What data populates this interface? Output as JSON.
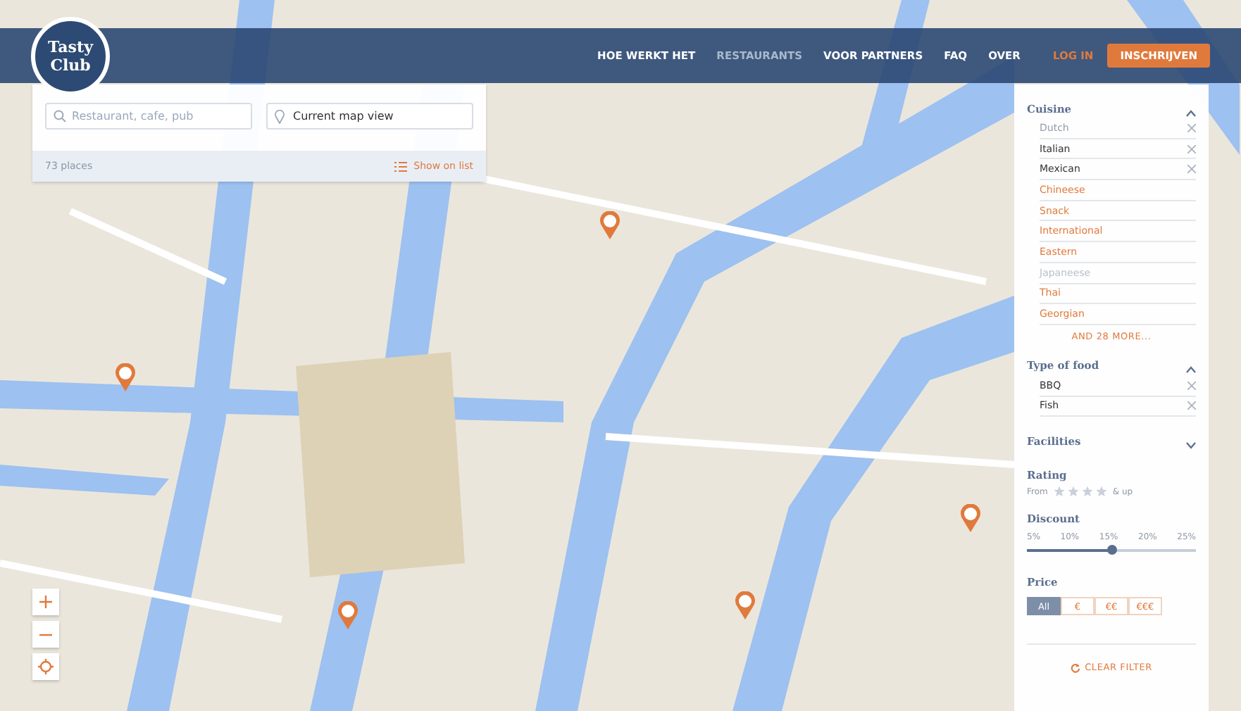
{
  "logo": {
    "line_1": "Tasty",
    "line_2": "Club"
  },
  "nav": {
    "items": [
      {
        "label": "HOE WERKT HET",
        "selected": false
      },
      {
        "label": "RESTAURANTS",
        "selected": true
      },
      {
        "label": "VOOR PARTNERS",
        "selected": false
      },
      {
        "label": "FAQ",
        "selected": false
      },
      {
        "label": "OVER",
        "selected": false
      }
    ],
    "login": "LOG IN",
    "signup": "INSCHRIJVEN"
  },
  "search": {
    "query_placeholder": "Restaurant, cafe, pub",
    "location_value": "Current map view",
    "count": "73 places",
    "show_on_list": "Show on list"
  },
  "filters": {
    "cuisine": {
      "title": "Cuisine",
      "expanded": true,
      "items": [
        {
          "label": "Dutch",
          "selected": true,
          "disabled": true
        },
        {
          "label": "Italian",
          "selected": true,
          "disabled": false
        },
        {
          "label": "Mexican",
          "selected": true,
          "disabled": false
        },
        {
          "label": "Chineese",
          "selected": false,
          "disabled": false
        },
        {
          "label": "Snack",
          "selected": false,
          "disabled": false
        },
        {
          "label": "International",
          "selected": false,
          "disabled": false
        },
        {
          "label": "Eastern",
          "selected": false,
          "disabled": false
        },
        {
          "label": "Japaneese",
          "selected": false,
          "disabled": true
        },
        {
          "label": "Thai",
          "selected": false,
          "disabled": false
        },
        {
          "label": "Georgian",
          "selected": false,
          "disabled": false
        }
      ],
      "more": "AND 28 MORE..."
    },
    "type_of_food": {
      "title": "Type of food",
      "expanded": true,
      "items": [
        {
          "label": "BBQ",
          "selected": true,
          "disabled": false
        },
        {
          "label": "Fish",
          "selected": true,
          "disabled": false
        }
      ]
    },
    "facilities": {
      "title": "Facilities",
      "expanded": false
    },
    "rating": {
      "title": "Rating",
      "from": "From",
      "stars": 0,
      "suffix": "& up"
    },
    "discount": {
      "title": "Discount",
      "ticks": [
        "5%",
        "10%",
        "15%",
        "20%",
        "25%"
      ],
      "level": 0.5
    },
    "price": {
      "title": "Price",
      "options": [
        {
          "label": "All",
          "selected": true
        },
        {
          "label": "€",
          "selected": false
        },
        {
          "label": "€€",
          "selected": false
        },
        {
          "label": "€€€",
          "selected": false
        }
      ]
    },
    "clear": "CLEAR FILTER"
  }
}
